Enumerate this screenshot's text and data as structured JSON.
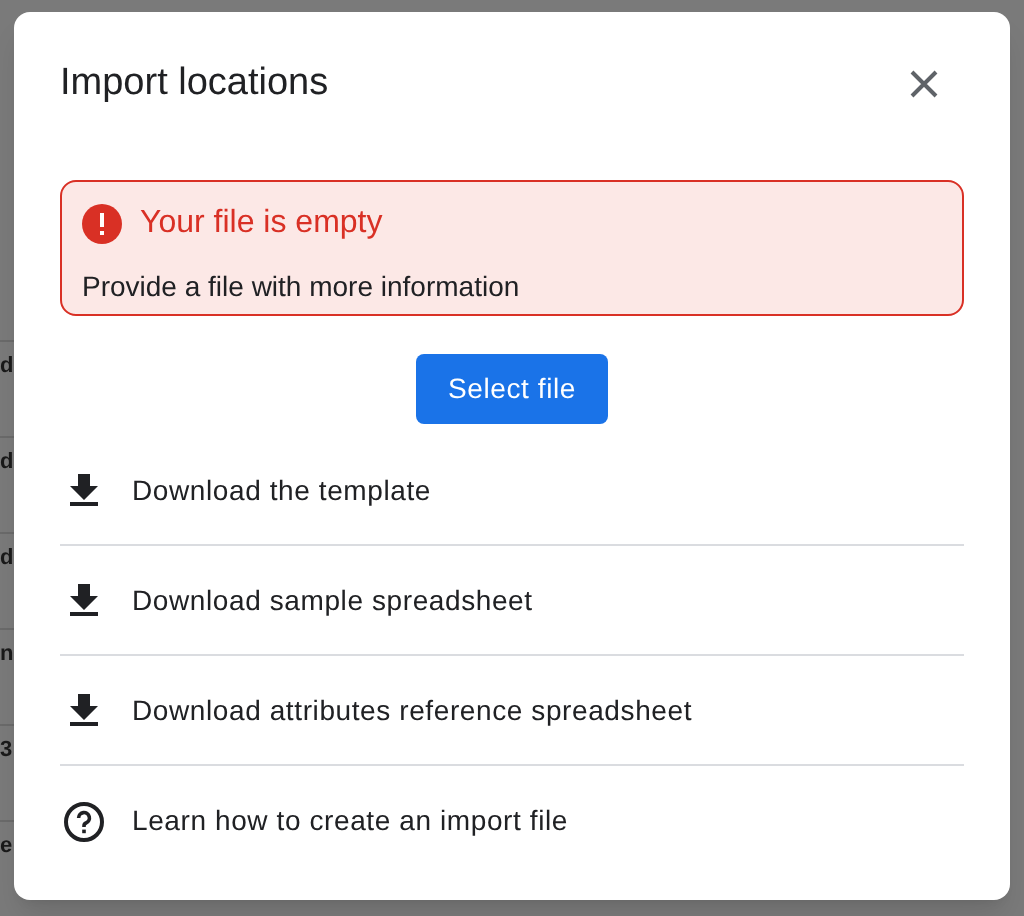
{
  "background": {
    "row_letters": [
      "d",
      "d",
      "d",
      "n",
      "3",
      "e"
    ]
  },
  "dialog": {
    "title": "Import locations",
    "error": {
      "title": "Your file is empty",
      "message": "Provide a file with more information"
    },
    "primary_button": "Select file",
    "links": [
      {
        "kind": "download",
        "label": "Download the template"
      },
      {
        "kind": "download",
        "label": "Download sample spreadsheet"
      },
      {
        "kind": "download",
        "label": "Download attributes reference spreadsheet"
      },
      {
        "kind": "help",
        "label": "Learn how to create an import file"
      }
    ]
  }
}
